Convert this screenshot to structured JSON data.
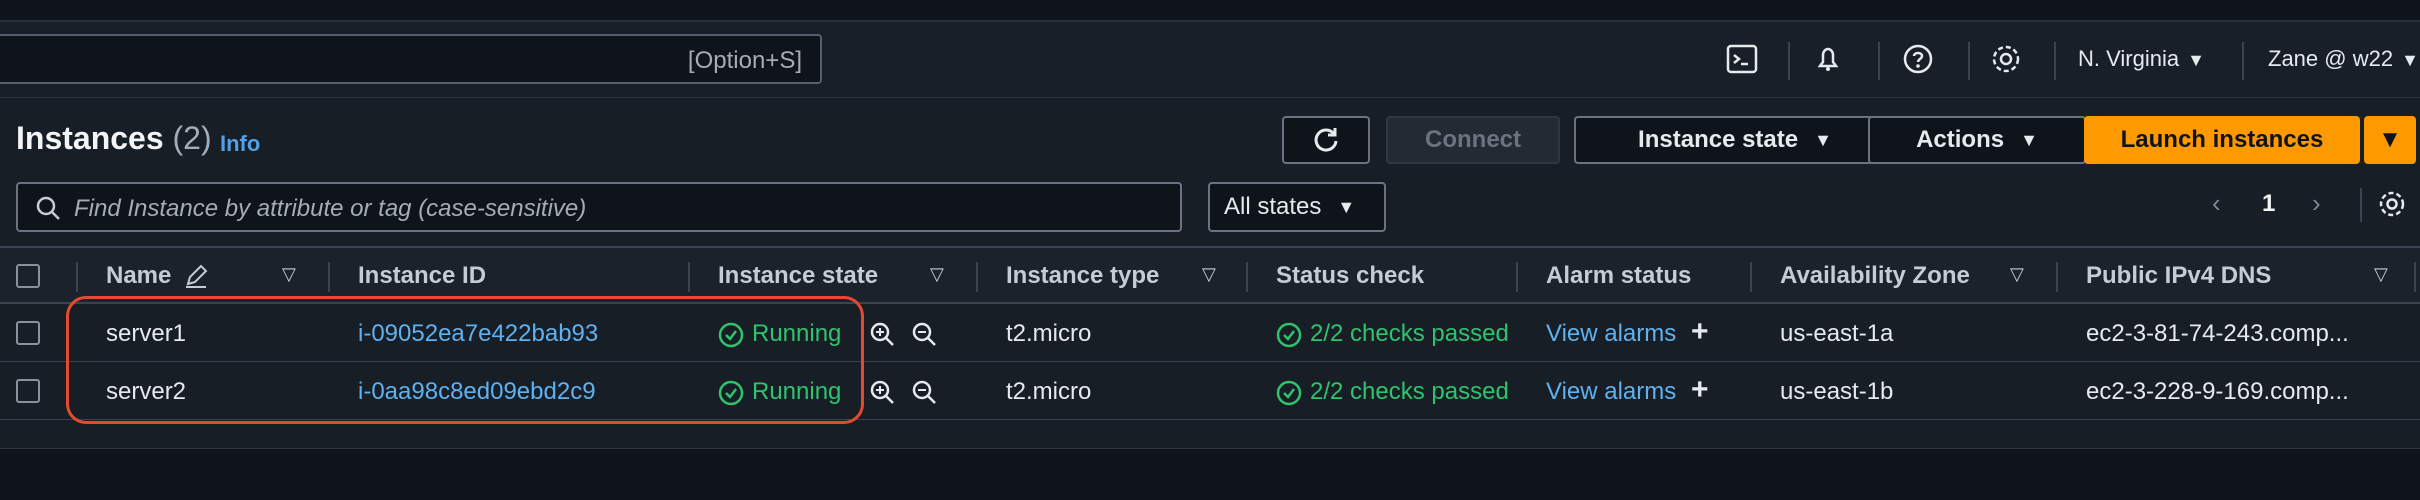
{
  "header": {
    "search_shortcut": "[Option+S]",
    "region": "N. Virginia",
    "user": "Zane @ w22",
    "icons": [
      "cloudshell-icon",
      "bell-icon",
      "help-icon",
      "settings-icon"
    ]
  },
  "instances": {
    "title": "Instances",
    "count": "(2)",
    "info": "Info",
    "buttons": {
      "refresh": "refresh-icon",
      "connect": "Connect",
      "instance_state": "Instance state",
      "actions": "Actions",
      "launch": "Launch instances"
    },
    "search_placeholder": "Find Instance by attribute or tag (case-sensitive)",
    "states_filter": "All states",
    "page": "1"
  },
  "table": {
    "columns": [
      "Name",
      "Instance ID",
      "Instance state",
      "Instance type",
      "Status check",
      "Alarm status",
      "Availability Zone",
      "Public IPv4 DNS"
    ],
    "rows": [
      {
        "name": "server1",
        "instance_id": "i-09052ea7e422bab93",
        "state": "Running",
        "type": "t2.micro",
        "status_check": "2/2 checks passed",
        "alarm": "View alarms",
        "zone": "us-east-1a",
        "dns": "ec2-3-81-74-243.comp..."
      },
      {
        "name": "server2",
        "instance_id": "i-0aa98c8ed09ebd2c9",
        "state": "Running",
        "type": "t2.micro",
        "status_check": "2/2 checks passed",
        "alarm": "View alarms",
        "zone": "us-east-1b",
        "dns": "ec2-3-228-9-169.comp..."
      }
    ]
  },
  "colors": {
    "primary": "#ff9900",
    "link": "#5fb1ef",
    "success": "#2fc36e",
    "highlight": "#e34a2f"
  }
}
